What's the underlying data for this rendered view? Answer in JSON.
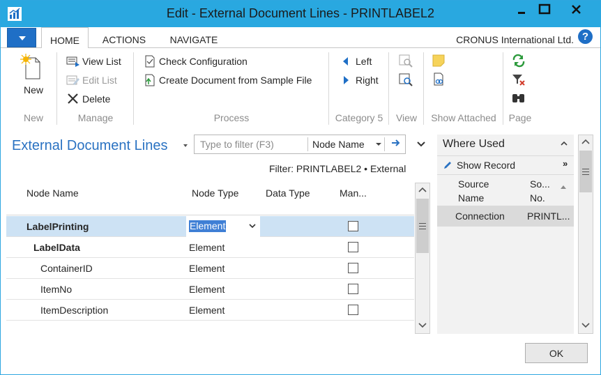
{
  "window": {
    "title": "Edit - External Document Lines - PRINTLABEL2",
    "controls": [
      "minimize-icon",
      "maximize-icon",
      "close-icon"
    ]
  },
  "ribbon_tabs": {
    "home": "HOME",
    "actions": "ACTIONS",
    "navigate": "NAVIGATE",
    "company": "CRONUS International Ltd.",
    "help": "?"
  },
  "ribbon": {
    "new": {
      "label": "New",
      "group": "New",
      "icon": "new-document-icon"
    },
    "manage": {
      "group": "Manage",
      "view_list": "View List",
      "edit_list": "Edit List",
      "delete": "Delete"
    },
    "process": {
      "group": "Process",
      "check_configuration": "Check Configuration",
      "create_document": "Create Document from Sample File"
    },
    "category5": {
      "group": "Category 5",
      "left": "Left",
      "right": "Right"
    },
    "view": {
      "group": "View"
    },
    "show_attached": {
      "group": "Show Attached"
    },
    "page": {
      "group": "Page"
    }
  },
  "list": {
    "title": "External Document Lines",
    "filter_placeholder": "Type to filter (F3)",
    "filter_field": "Node Name",
    "filter_text": "Filter: PRINTLABEL2 • External",
    "columns": {
      "node_name": "Node Name",
      "node_type": "Node Type",
      "data_type": "Data Type",
      "mandatory": "Man..."
    },
    "rows": [
      {
        "node_name": "LabelPrinting",
        "node_type": "Element",
        "data_type": "",
        "mandatory": false,
        "level": 0,
        "bold": true,
        "selected": true
      },
      {
        "node_name": "LabelData",
        "node_type": "Element",
        "data_type": "",
        "mandatory": false,
        "level": 1,
        "bold": true,
        "selected": false
      },
      {
        "node_name": "ContainerID",
        "node_type": "Element",
        "data_type": "",
        "mandatory": false,
        "level": 2,
        "bold": false,
        "selected": false
      },
      {
        "node_name": "ItemNo",
        "node_type": "Element",
        "data_type": "",
        "mandatory": false,
        "level": 2,
        "bold": false,
        "selected": false
      },
      {
        "node_name": "ItemDescription",
        "node_type": "Element",
        "data_type": "",
        "mandatory": false,
        "level": 2,
        "bold": false,
        "selected": false
      }
    ]
  },
  "factbox": {
    "title": "Where Used",
    "show_record": "Show Record",
    "col_source_name": "Source Name",
    "col_source_no": "So... No.",
    "rows": [
      {
        "source_name": "Connection",
        "source_no": "PRINTL..."
      }
    ]
  },
  "footer": {
    "ok": "OK"
  },
  "colors": {
    "titlebar": "#29a8e0",
    "accent": "#2a72c2",
    "selection": "#cde2f4"
  }
}
